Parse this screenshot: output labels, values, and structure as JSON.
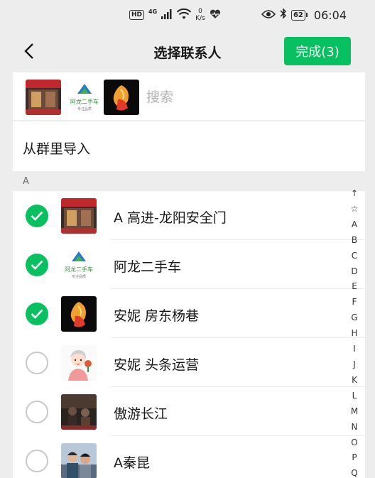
{
  "status_bar": {
    "hd": "HD",
    "network": "4G",
    "speed_value": "0",
    "speed_unit": "K/s",
    "battery": "62",
    "time": "06:04"
  },
  "nav": {
    "title": "选择联系人",
    "done_label": "完成(3)"
  },
  "search": {
    "placeholder": "搜索"
  },
  "import": {
    "label": "从群里导入"
  },
  "section": {
    "letter": "A"
  },
  "contacts": [
    {
      "name": "A 高进-龙阳安全门",
      "checked": true,
      "avatar": "shop-avatar"
    },
    {
      "name": "阿龙二手车",
      "checked": true,
      "avatar": "car-logo-avatar"
    },
    {
      "name": "安妮 房东杨巷",
      "checked": true,
      "avatar": "flower-avatar"
    },
    {
      "name": "安妮 头条运营",
      "checked": false,
      "avatar": "cartoon-girl-avatar"
    },
    {
      "name": "傲游长江",
      "checked": false,
      "avatar": "photo-avatar"
    },
    {
      "name": "A秦昆",
      "checked": false,
      "avatar": "people-avatar"
    }
  ],
  "avatar_logo_text": {
    "car_main": "阿龙二手车",
    "car_sub": "专注品质"
  },
  "index_letters": [
    "↑",
    "☆",
    "A",
    "B",
    "C",
    "D",
    "E",
    "F",
    "G",
    "H",
    "I",
    "J",
    "K",
    "L",
    "M",
    "N",
    "O",
    "P",
    "Q"
  ],
  "colors": {
    "accent": "#07c160",
    "background": "#ededed"
  }
}
